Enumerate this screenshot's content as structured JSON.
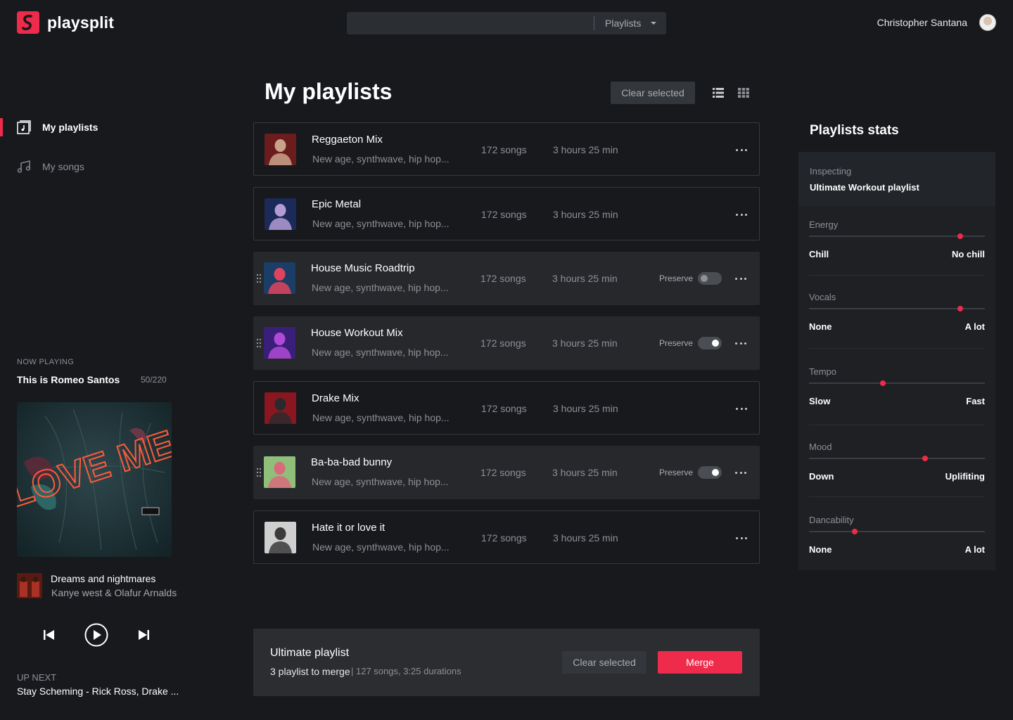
{
  "app": {
    "name": "playsplit"
  },
  "search": {
    "value": "",
    "placeholder": "",
    "scope": "Playlists"
  },
  "user": {
    "name": "Christopher Santana"
  },
  "sidebar": {
    "items": [
      {
        "label": "My playlists",
        "icon": "playlist-icon",
        "active": true
      },
      {
        "label": "My songs",
        "icon": "music-note-icon",
        "active": false
      }
    ]
  },
  "now_playing": {
    "heading": "NOW PLAYING",
    "title": "This is Romeo Santos",
    "count": "50/220",
    "album_text": "LOVE ME",
    "track": {
      "title": "Dreams and nightmares",
      "artist": "Kanye west & Olafur Arnalds"
    },
    "up_next_heading": "UP NEXT",
    "up_next": "Stay Scheming - Rick Ross, Drake ..."
  },
  "main": {
    "title": "My playlists",
    "clear_label": "Clear selected",
    "preserve_label": "Preserve",
    "playlists": [
      {
        "name": "Reggaeton Mix",
        "genres": "New age, synthwave, hip hop...",
        "songs": "172 songs",
        "duration": "3 hours 25 min",
        "selected": false,
        "preserve": null,
        "thumb": [
          "#6b1d1d",
          "#c9a38a"
        ]
      },
      {
        "name": "Epic Metal",
        "genres": "New age, synthwave, hip hop...",
        "songs": "172 songs",
        "duration": "3 hours 25 min",
        "selected": false,
        "preserve": null,
        "thumb": [
          "#1c2a5a",
          "#b39bd6"
        ]
      },
      {
        "name": "House Music Roadtrip",
        "genres": "New age, synthwave, hip hop...",
        "songs": "172 songs",
        "duration": "3 hours 25 min",
        "selected": true,
        "preserve": false,
        "thumb": [
          "#1b3d66",
          "#e0445d"
        ]
      },
      {
        "name": "House Workout Mix",
        "genres": "New age, synthwave, hip hop...",
        "songs": "172 songs",
        "duration": "3 hours 25 min",
        "selected": true,
        "preserve": true,
        "thumb": [
          "#3a1f7a",
          "#b04ad6"
        ]
      },
      {
        "name": "Drake Mix",
        "genres": "New age, synthwave, hip hop...",
        "songs": "172 songs",
        "duration": "3 hours 25 min",
        "selected": false,
        "preserve": null,
        "thumb": [
          "#8a1620",
          "#2a2a2e"
        ]
      },
      {
        "name": "Ba-ba-bad bunny",
        "genres": "New age, synthwave, hip hop...",
        "songs": "172 songs",
        "duration": "3 hours 25 min",
        "selected": true,
        "preserve": true,
        "thumb": [
          "#8fbf7a",
          "#d96a7a"
        ]
      },
      {
        "name": "Hate it or love it",
        "genres": "New age, synthwave, hip hop...",
        "songs": "172 songs",
        "duration": "3 hours 25 min",
        "selected": false,
        "preserve": null,
        "thumb": [
          "#cfcfcf",
          "#3a3a3a"
        ]
      }
    ],
    "merge": {
      "title": "Ultimate playlist",
      "count": "3 playlist to merge",
      "detail": "| 127 songs, 3:25 durations",
      "clear_label": "Clear selected",
      "merge_label": "Merge"
    }
  },
  "stats": {
    "title": "Playlists stats",
    "inspecting_heading": "Inspecting",
    "inspecting_value": "Ultimate Workout playlist",
    "items": [
      {
        "label": "Energy",
        "low": "Chill",
        "high": "No chill",
        "value": 0.86
      },
      {
        "label": "Vocals",
        "low": "None",
        "high": "A lot",
        "value": 0.86
      },
      {
        "label": "Tempo",
        "low": "Slow",
        "high": "Fast",
        "value": 0.42
      },
      {
        "label": "Mood",
        "low": "Down",
        "high": "Uplifiting",
        "value": 0.66
      },
      {
        "label": "Dancability",
        "low": "None",
        "high": "A lot",
        "value": 0.26
      }
    ]
  },
  "colors": {
    "accent": "#ee2b4b",
    "background": "#17191d",
    "row_selected": "#26282c"
  }
}
